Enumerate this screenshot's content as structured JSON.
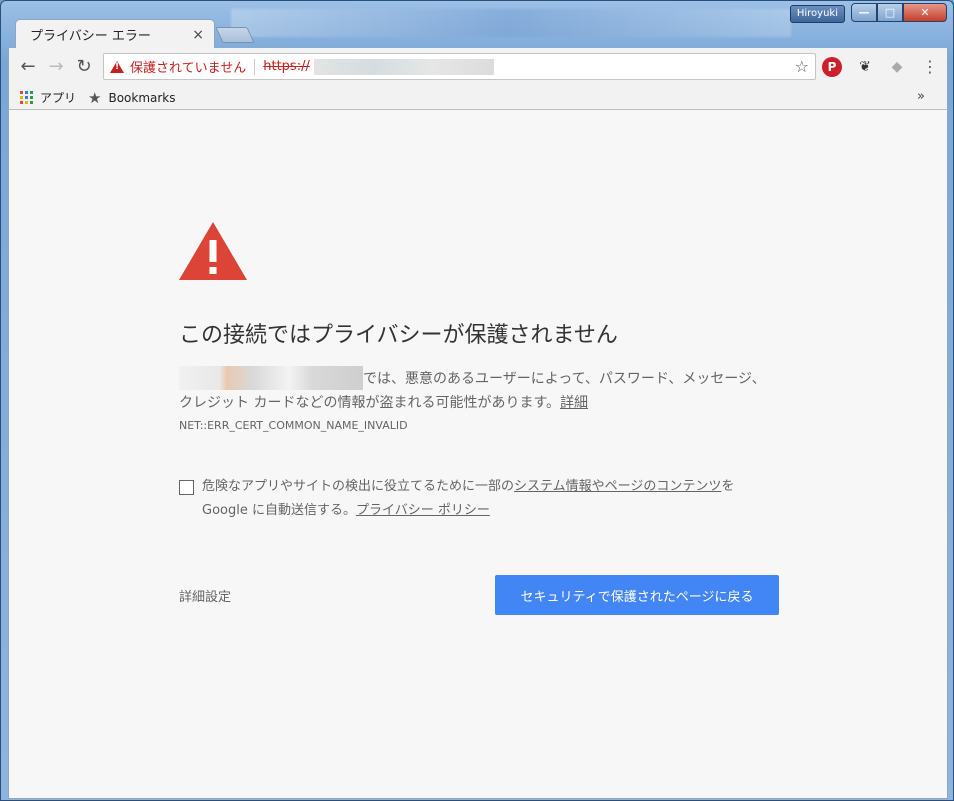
{
  "window": {
    "user_name": "Hiroyuki",
    "minimize_glyph": "—",
    "maximize_glyph": "□",
    "close_glyph": "✕"
  },
  "tab": {
    "title": "プライバシー エラー",
    "close_glyph": "×"
  },
  "toolbar": {
    "back_glyph": "←",
    "forward_glyph": "→",
    "reload_glyph": "↻",
    "omnibox_status": "保護されていません",
    "omnibox_scheme": "https://",
    "bookmark_star_glyph": "☆",
    "extension_icons": [
      "pinterest-icon",
      "evernote-icon",
      "dropbox-icon"
    ],
    "menu_glyph": "⋮"
  },
  "bookmarks": {
    "apps_label": "アプリ",
    "bookmarks_label": "Bookmarks",
    "overflow_glyph": "»"
  },
  "interstitial": {
    "heading": "この接続ではプライバシーが保護されません",
    "description_suffix": "では、悪意のあるユーザーによって、パスワード、メッセージ、クレジット カードなどの情報が盗まれる可能性があります。",
    "details_link": "詳細",
    "error_code": "NET::ERR_CERT_COMMON_NAME_INVALID",
    "checkbox_text_1": "危険なアプリやサイトの検出に役立てるために一部の",
    "checkbox_link_system": "システム情報やページのコンテンツ",
    "checkbox_text_2": "を Google に自動送信する。",
    "checkbox_link_privacy": "プライバシー ポリシー",
    "advanced_label": "詳細設定",
    "back_to_safety_label": "セキュリティで保護されたページに戻る"
  },
  "colors": {
    "warning_red": "#db4437",
    "primary_button": "#4285f4",
    "insecure_red": "#c5221f"
  }
}
